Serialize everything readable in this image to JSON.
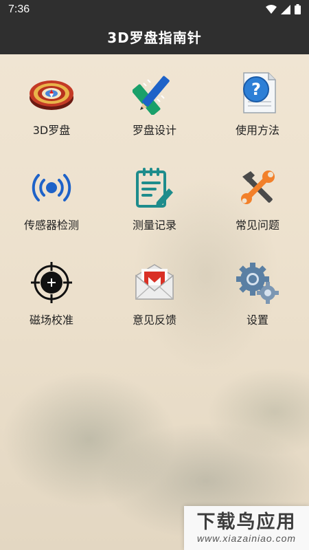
{
  "status": {
    "time": "7:36"
  },
  "app": {
    "title": "3D罗盘指南针"
  },
  "menu": [
    {
      "label": "3D罗盘",
      "icon": "compass-icon"
    },
    {
      "label": "罗盘设计",
      "icon": "pencil-ruler-icon"
    },
    {
      "label": "使用方法",
      "icon": "help-document-icon"
    },
    {
      "label": "传感器检测",
      "icon": "sensor-signal-icon"
    },
    {
      "label": "测量记录",
      "icon": "clipboard-edit-icon"
    },
    {
      "label": "常见问题",
      "icon": "tools-icon"
    },
    {
      "label": "磁场校准",
      "icon": "crosshair-icon"
    },
    {
      "label": "意见反馈",
      "icon": "mail-icon"
    },
    {
      "label": "设置",
      "icon": "gears-icon"
    }
  ],
  "watermark": {
    "title": "下载鸟应用",
    "url": "www.xiazainiao.com"
  },
  "colors": {
    "bar": "#2f2f2f",
    "accent_blue": "#1e62c8",
    "accent_green": "#1aa06a"
  }
}
